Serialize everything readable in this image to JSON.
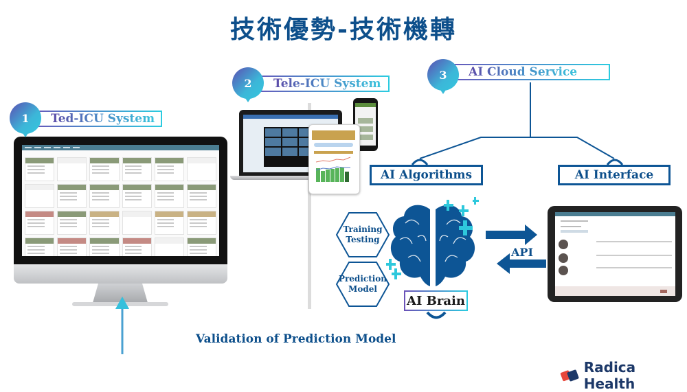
{
  "title": "技術優勢-技術機轉",
  "sections": [
    {
      "number": "1",
      "label": "Ted-ICU System"
    },
    {
      "number": "2",
      "label": "Tele-ICU System"
    },
    {
      "number": "3",
      "label": "AI Cloud Service"
    }
  ],
  "ai_cloud": {
    "algorithms_label": "AI  Algorithms",
    "interface_label": "AI  Interface"
  },
  "ai_brain": {
    "label": "AI Brain",
    "hexagons": [
      {
        "line1": "Training",
        "line2": "Testing"
      },
      {
        "line1": "Prediction",
        "line2": "Model"
      }
    ]
  },
  "api_label": "API",
  "feedback_label": "Validation of Prediction Model",
  "brand": {
    "name": "Radica Health",
    "colors": {
      "primary": "#1c3868",
      "accent": "#e8473b"
    }
  },
  "colors": {
    "title_blue": "#0d4f8b",
    "gradient_start": "#6a52b8",
    "gradient_end": "#2ccbe0",
    "cyan_plus": "#2ec8dc"
  },
  "icu_cards": [
    "#8a9a78",
    "#f1f1f1",
    "#8a9a78",
    "#8a9a78",
    "#8a9a78",
    "#f1f1f1",
    "#f1f1f1",
    "#8a9a78",
    "#8a9a78",
    "#8a9a78",
    "#8a9a78",
    "#8a9a78",
    "#c48a84",
    "#8a9a78",
    "#c9b284",
    "#f1f1f1",
    "#c9b284",
    "#c9b284",
    "#8a9a78",
    "#c48a84",
    "#8a9a78",
    "#c48a84",
    "#f1f1f1",
    "#8a9a78"
  ]
}
